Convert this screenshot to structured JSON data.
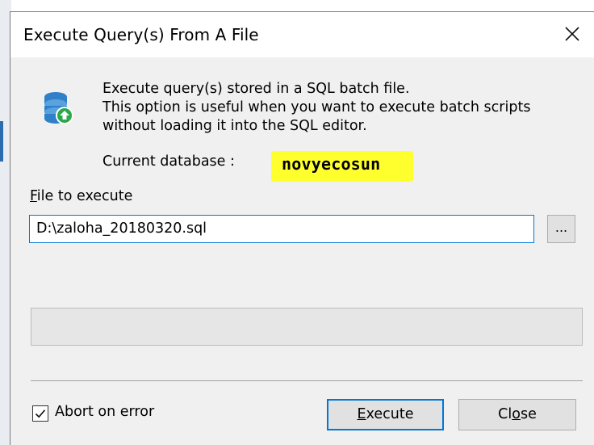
{
  "window": {
    "title": "Execute Query(s) From A File"
  },
  "info": {
    "line1": "Execute query(s) stored in a SQL batch file.",
    "line2": "This option is useful when you want to execute batch scripts",
    "line3": "without loading it into the SQL editor."
  },
  "database": {
    "label": "Current database :",
    "name": "novyecosun"
  },
  "file": {
    "label_accel": "F",
    "label_rest": "ile to execute",
    "value": "D:\\zaloha_20180320.sql",
    "browse_label": "..."
  },
  "progress": {
    "value": 0
  },
  "options": {
    "abort_on_error_label": "Abort on error",
    "abort_on_error_checked": true
  },
  "buttons": {
    "execute_accel": "E",
    "execute_rest": "xecute",
    "close_pre": "Cl",
    "close_accel": "o",
    "close_post": "se"
  },
  "colors": {
    "accent": "#0078d7",
    "highlight": "#ffff2e",
    "icon_blue": "#2f80c8",
    "icon_green": "#2aa84a"
  },
  "icons": {
    "dialog_icon": "database-upload-icon",
    "close_icon": "close-icon",
    "check_icon": "check-icon"
  }
}
